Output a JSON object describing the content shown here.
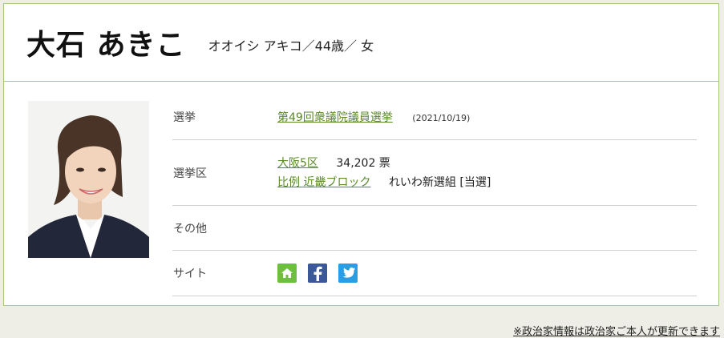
{
  "profile": {
    "name": "大石 あきこ",
    "kana_age_gender": "オオイシ アキコ／44歳／ 女"
  },
  "rows": {
    "election": {
      "label": "選挙",
      "link": "第49回衆議院議員選挙",
      "date": "(2021/10/19)"
    },
    "district": {
      "label": "選挙区",
      "district_link": "大阪5区",
      "votes": "34,202 票",
      "pr_link": "比例 近畿ブロック",
      "party_result": "れいわ新選組 [当選]"
    },
    "other": {
      "label": "その他"
    },
    "site": {
      "label": "サイト",
      "icons": [
        "home-icon",
        "facebook-icon",
        "twitter-icon"
      ]
    }
  },
  "footer": {
    "note": "※政治家情報は政治家ご本人が更新できます"
  },
  "colors": {
    "accent_green": "#5a8a28",
    "border_green": "#a3c97d",
    "home": "#6cbf3f",
    "facebook": "#3b5998",
    "twitter": "#2a9ee4"
  }
}
